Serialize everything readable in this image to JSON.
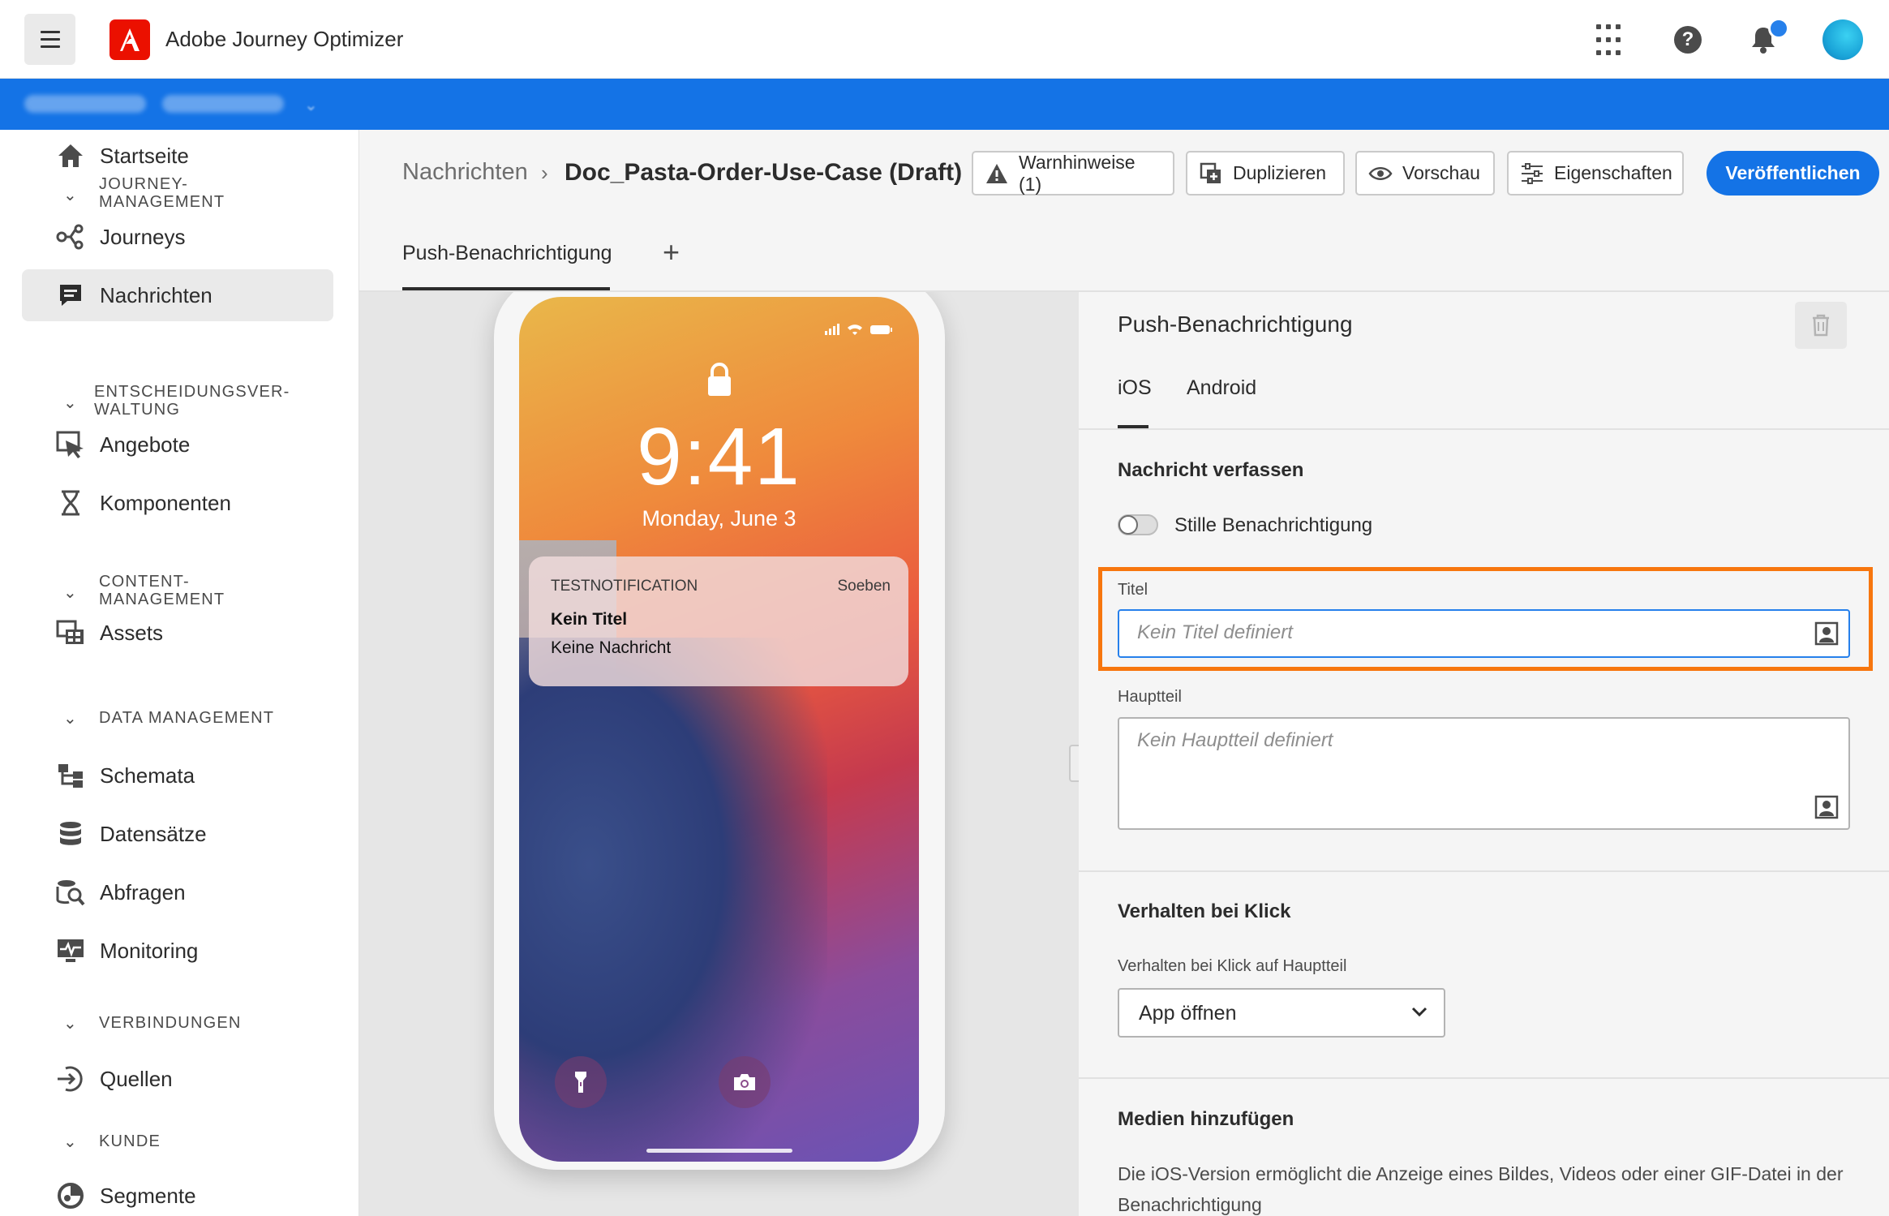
{
  "app": {
    "title": "Adobe Journey Optimizer",
    "accent_color": "#1473e6",
    "logo_color": "#eb1000"
  },
  "topbar_icons": [
    "apps-grid-icon",
    "help-icon",
    "bell-icon",
    "avatar"
  ],
  "nav": {
    "items": [
      {
        "label": "Startseite",
        "icon": "home-icon"
      },
      {
        "section": "JOURNEY-\nMANAGEMENT"
      },
      {
        "label": "Journeys",
        "icon": "journeys-icon"
      },
      {
        "label": "Nachrichten",
        "icon": "message-icon",
        "active": true
      },
      {
        "section": "ENTSCHEIDUNGSVER-\nWALTUNG"
      },
      {
        "label": "Angebote",
        "icon": "offers-icon"
      },
      {
        "label": "Komponenten",
        "icon": "components-icon"
      },
      {
        "section": "CONTENT-\nMANAGEMENT"
      },
      {
        "label": "Assets",
        "icon": "assets-icon"
      },
      {
        "section": "DATA MANAGEMENT"
      },
      {
        "label": "Schemata",
        "icon": "schema-icon"
      },
      {
        "label": "Datensätze",
        "icon": "datasets-icon"
      },
      {
        "label": "Abfragen",
        "icon": "queries-icon"
      },
      {
        "label": "Monitoring",
        "icon": "monitoring-icon"
      },
      {
        "section": "VERBINDUNGEN"
      },
      {
        "label": "Quellen",
        "icon": "sources-icon"
      },
      {
        "section": "KUNDE"
      },
      {
        "label": "Segmente",
        "icon": "segments-icon"
      }
    ]
  },
  "header": {
    "breadcrumb_parent": "Nachrichten",
    "breadcrumb_current": "Doc_Pasta-Order-Use-Case (Draft)",
    "buttons": {
      "warnings": "Warnhinweise (1)",
      "duplicate": "Duplizieren",
      "preview": "Vorschau",
      "properties": "Eigenschaften",
      "publish": "Veröffentlichen"
    },
    "tab": "Push-Benachrichtigung"
  },
  "phone": {
    "time": "9:41",
    "date": "Monday, June 3",
    "notification": {
      "app": "TESTNOTIFICATION",
      "time": "Soeben",
      "title": "Kein Titel",
      "body": "Keine Nachricht"
    }
  },
  "panel": {
    "title": "Push-Benachrichtigung",
    "tabs": [
      "iOS",
      "Android"
    ],
    "selected_tab": "iOS",
    "compose_heading": "Nachricht verfassen",
    "silent_label": "Stille Benachrichtigung",
    "silent_on": false,
    "title_label": "Titel",
    "title_placeholder": "Kein Titel definiert",
    "body_label": "Hauptteil",
    "body_placeholder": "Kein Hauptteil definiert",
    "click_heading": "Verhalten bei Klick",
    "click_label": "Verhalten bei Klick auf Hauptteil",
    "click_value": "App öffnen",
    "media_heading": "Medien hinzufügen",
    "media_text": "Die iOS-Version ermöglicht die Anzeige eines Bildes, Videos oder einer GIF-Datei in der Benachrichtigung",
    "highlight_color": "#f7760e"
  }
}
